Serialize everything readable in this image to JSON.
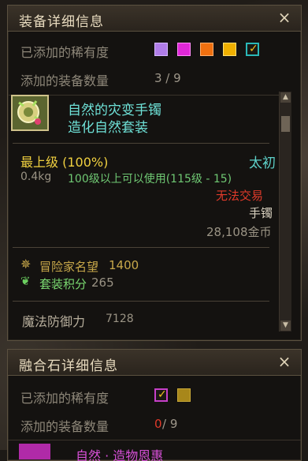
{
  "equip_panel": {
    "title": "装备详细信息",
    "close": "×",
    "rarity_label": "已添加的稀有度",
    "count_label": "添加的装备数量",
    "count_value": "3 / 9",
    "rarity_colors": [
      "#b07de8",
      "#e028d8",
      "#f07010",
      "#f0b000",
      "#2ab8b8"
    ],
    "item": {
      "name": "自然的灾变手镯",
      "set_name": "造化自然套装",
      "grade": "最上级  (100%)",
      "origin": "太初",
      "weight": "0.4kg",
      "level_req": "100级以上可以使用(115级 - 15)",
      "trade": "无法交易",
      "slot": "手镯",
      "price": "28,108金币",
      "fame_label": "冒险家名望",
      "fame_value": "1400",
      "set_points_label": "套装积分",
      "set_points_value": "265",
      "magic_def_label": "魔法防御力",
      "magic_def_value": "7128"
    }
  },
  "fusion_panel": {
    "title": "融合石详细信息",
    "close": "×",
    "rarity_label": "已添加的稀有度",
    "count_label": "添加的装备数量",
    "count_current": "0",
    "count_total": " / 9",
    "rarity_colors": [
      "#c640c8",
      "#a8871a"
    ],
    "next_item_partial": "自然 · 造物恩惠"
  },
  "colors": {
    "item_name": "#6fe2d8",
    "grade": "#f0d040",
    "origin": "#5dd0c8",
    "level_req": "#6fc873",
    "trade": "#e03a2a",
    "fame": "#c8a84a",
    "set_points": "#7ad870"
  }
}
